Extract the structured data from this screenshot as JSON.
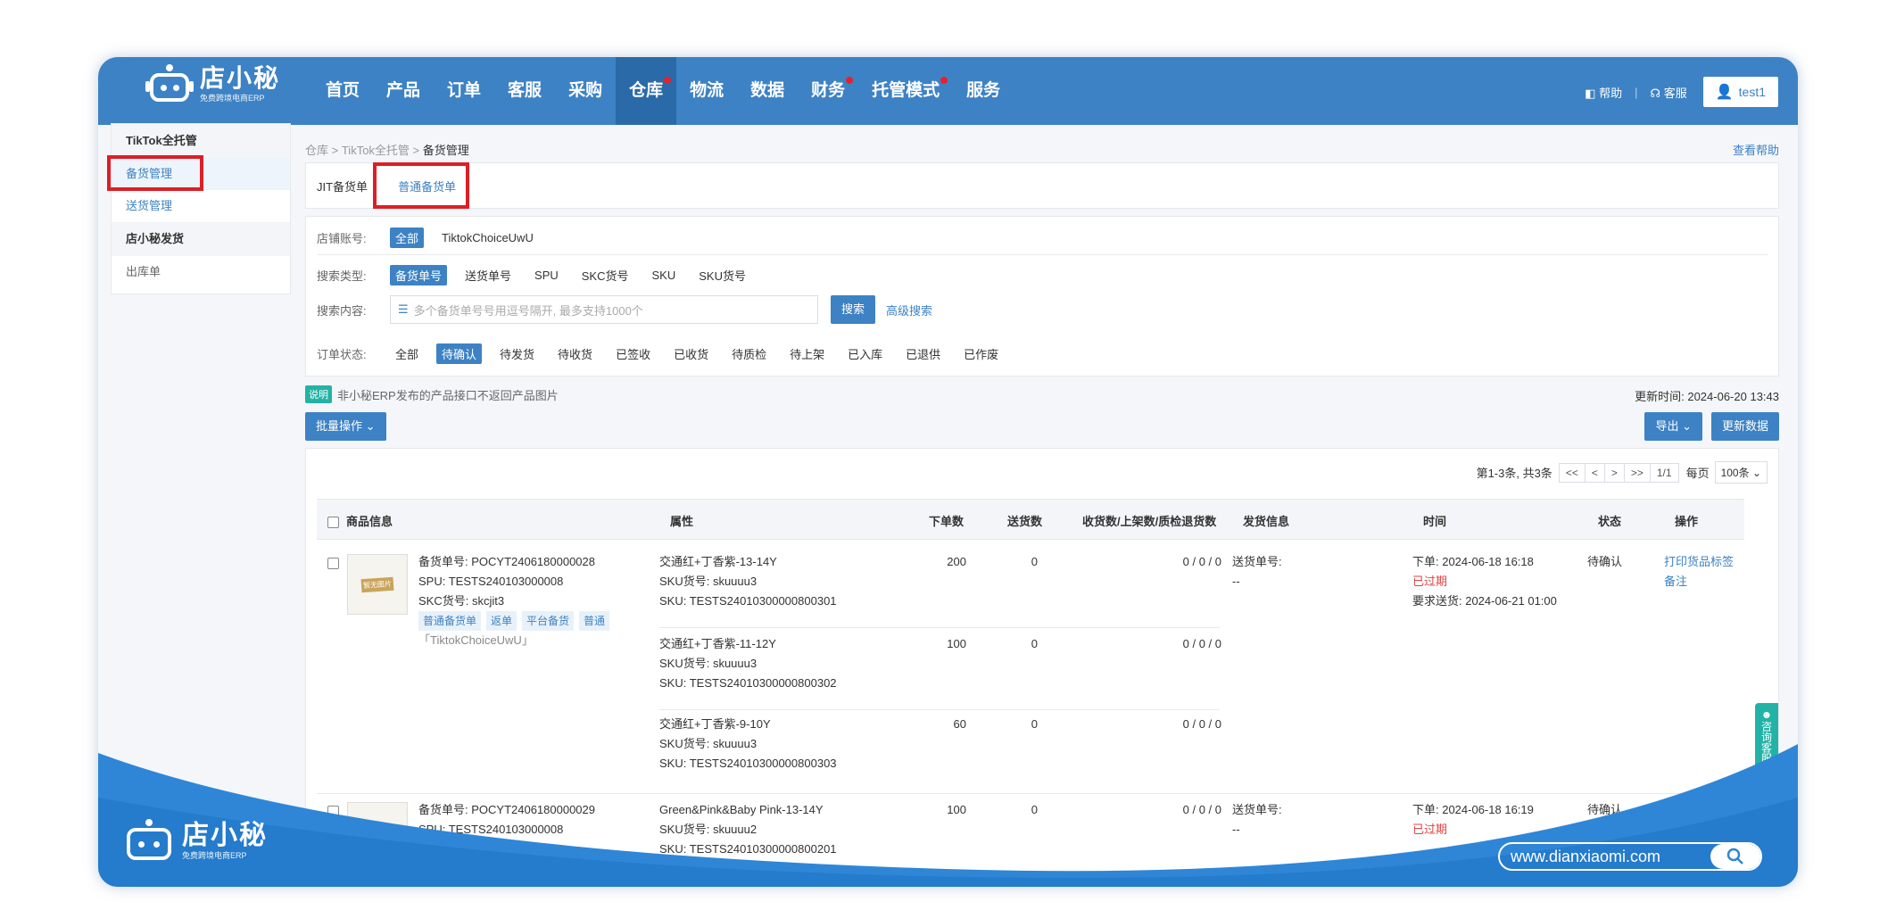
{
  "brand": {
    "logo_text": "店小秘",
    "logo_sub": "免费跨境电商ERP"
  },
  "nav": {
    "items": [
      {
        "label": "首页",
        "dot": false,
        "active": false
      },
      {
        "label": "产品",
        "dot": false,
        "active": false
      },
      {
        "label": "订单",
        "dot": false,
        "active": false
      },
      {
        "label": "客服",
        "dot": false,
        "active": false
      },
      {
        "label": "采购",
        "dot": false,
        "active": false
      },
      {
        "label": "仓库",
        "dot": true,
        "active": true
      },
      {
        "label": "物流",
        "dot": false,
        "active": false
      },
      {
        "label": "数据",
        "dot": false,
        "active": false
      },
      {
        "label": "财务",
        "dot": true,
        "active": false
      },
      {
        "label": "托管模式",
        "dot": true,
        "active": false
      },
      {
        "label": "服务",
        "dot": false,
        "active": false
      }
    ],
    "help": "帮助",
    "support": "客服",
    "user": "test1"
  },
  "sidebar": {
    "group1": "TikTok全托管",
    "item1": "备货管理",
    "item2": "送货管理",
    "group2": "店小秘发货",
    "item3": "出库单"
  },
  "breadcrumb": {
    "a": "仓库",
    "b": "TikTok全托管",
    "c": "备货管理"
  },
  "help_link": "查看帮助",
  "tabs": {
    "jit": "JIT备货单",
    "normal": "普通备货单"
  },
  "filters": {
    "shop_label": "店铺账号:",
    "shop_all": "全部",
    "shop_name": "TiktokChoiceUwU",
    "type_label": "搜索类型:",
    "types": [
      "备货单号",
      "送货单号",
      "SPU",
      "SKC货号",
      "SKU",
      "SKU货号"
    ],
    "content_label": "搜索内容:",
    "search_placeholder": "多个备货单号号用逗号隔开, 最多支持1000个",
    "search_btn": "搜索",
    "advanced": "高级搜索",
    "status_label": "订单状态:",
    "statuses": [
      "全部",
      "待确认",
      "待发货",
      "待收货",
      "已签收",
      "已收货",
      "待质检",
      "待上架",
      "已入库",
      "已退供",
      "已作废"
    ]
  },
  "notice": {
    "tag": "说明",
    "text": "非小秘ERP发布的产品接口不返回产品图片"
  },
  "update_time": "更新时间: 2024-06-20 13:43",
  "batch_btn": "批量操作",
  "export_btn": "导出",
  "refresh_btn": "更新数据",
  "pager": {
    "summary": "第1-3条, 共3条",
    "first": "<<",
    "prev": "<",
    "next": ">",
    "last": ">>",
    "page": "1/1",
    "per_label": "每页",
    "per_value": "100条"
  },
  "table": {
    "headers": [
      "商品信息",
      "属性",
      "下单数",
      "送货数",
      "收货数/上架数/质检退货数",
      "发货信息",
      "时间",
      "状态",
      "操作"
    ],
    "rows": [
      {
        "thumb_note": "暂无图片",
        "order_no": "备货单号: POCYT2406180000028",
        "spu": "SPU: TESTS240103000008",
        "skc": "SKC货号: skcjit3",
        "tags": [
          "普通备货单",
          "返单",
          "平台备货",
          "普通"
        ],
        "shop": "「TiktokChoiceUwU」",
        "subs": [
          {
            "attr": "交通红+丁香紫-13-14Y",
            "sku_no": "SKU货号: skuuuu3",
            "sku": "SKU: TESTS24010300000800301",
            "ordered": "200",
            "sent": "0",
            "recv": "0 / 0 / 0"
          },
          {
            "attr": "交通红+丁香紫-11-12Y",
            "sku_no": "SKU货号: skuuuu3",
            "sku": "SKU: TESTS24010300000800302",
            "ordered": "100",
            "sent": "0",
            "recv": "0 / 0 / 0"
          },
          {
            "attr": "交通红+丁香紫-9-10Y",
            "sku_no": "SKU货号: skuuuu3",
            "sku": "SKU: TESTS24010300000800303",
            "ordered": "60",
            "sent": "0",
            "recv": "0 / 0 / 0"
          }
        ],
        "ship_label": "送货单号:",
        "ship_value": "--",
        "time_order": "下单: 2024-06-18 16:18",
        "expired": "已过期",
        "time_req": "要求送货: 2024-06-21 01:00",
        "status": "待确认",
        "action1": "打印货品标签",
        "action2": "备注"
      },
      {
        "order_no": "备货单号: POCYT2406180000029",
        "spu": "SPU: TESTS240103000008",
        "subs": [
          {
            "attr": "Green&Pink&Baby Pink-13-14Y",
            "sku_no": "SKU货号: skuuuu2",
            "sku": "SKU: TESTS24010300000800201",
            "ordered": "100",
            "sent": "0",
            "recv": "0 / 0 / 0"
          }
        ],
        "ship_label": "送货单号:",
        "ship_value": "--",
        "time_order": "下单: 2024-06-18 16:19",
        "expired": "已过期",
        "status": "待确认"
      }
    ]
  },
  "float_service": "咨询客服",
  "footer": {
    "logo_text": "店小秘",
    "logo_sub": "免费跨境电商ERP",
    "url": "www.dianxiaomi.com"
  },
  "colors": {
    "accent": "#3d82c4",
    "highlight": "#dd1e26",
    "teal": "#22b3a6"
  }
}
